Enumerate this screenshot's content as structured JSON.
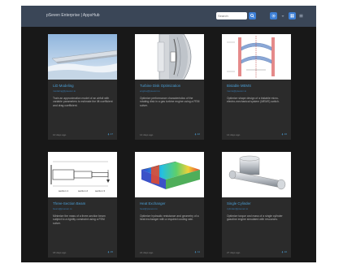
{
  "header": {
    "title": "pSeven Enterprise | AppsHub",
    "search_placeholder": "Search",
    "search_button_icon": "search-icon",
    "tools": [
      "gear-icon",
      "caret-down-icon",
      "grid-view-icon",
      "list-view-icon"
    ]
  },
  "colors": {
    "background": "#181818",
    "topbar": "#3a4657",
    "card": "#2b2b2b",
    "accent": "#4b9fd6",
    "button": "#3d7fd6"
  },
  "cards": [
    {
      "title": "LiD Modeling",
      "link": "modeling@pseven.io",
      "description": "Train an approximation model of an airfoil with variable parameters to estimate the lift coefficient and drag coefficient.",
      "time": "10 days ago",
      "count": "17",
      "image": "airplane-wing"
    },
    {
      "title": "Turbine Disk Optimization",
      "link": "engine@pseven.io",
      "description": "Optimize performance characteristics of the rotating disk in a gas turbine engine using a FEM solver.",
      "time": "14 days ago",
      "count": "22",
      "image": "turbine-disk"
    },
    {
      "title": "Bistable MEMS",
      "link": "mems@pseven.io",
      "description": "Optimize shape design of a bistable micro-electro-mechanical system (MEMS) switch.",
      "time": "14 days ago",
      "count": "16",
      "image": "mems-switch"
    },
    {
      "title": "Three-Section Beam",
      "link": "beam@pseven.io",
      "description": "Minimize the mass of a three-section beam subject to a rigidity constraint using a FEM solver.",
      "time": "18 days ago",
      "count": "15",
      "image": "beam-diagram",
      "labels": [
        "section 1",
        "section 2",
        "section 3"
      ]
    },
    {
      "title": "Heat Exchanger",
      "link": "heat@pseven.io",
      "description": "Optimize hydraulic resistance and geometry of a heat exchanger with a required cooling rate.",
      "time": "21 days ago",
      "count": "11",
      "image": "heat-exchanger"
    },
    {
      "title": "Single Cylinder",
      "link": "cylinder@pseven.io",
      "description": "Optimize torque and mass of a single cylinder gasoline engine simulated with resources.",
      "time": "27 days ago",
      "count": "10",
      "image": "crankshaft"
    }
  ]
}
